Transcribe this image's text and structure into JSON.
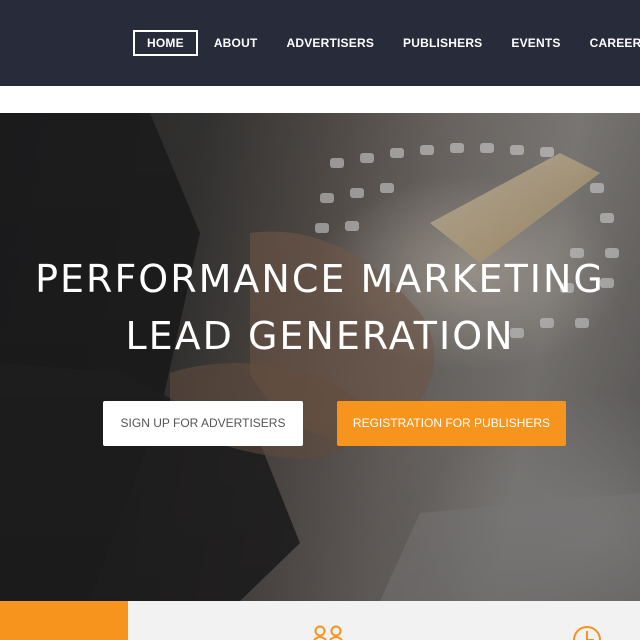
{
  "nav": {
    "items": [
      {
        "label": "HOME",
        "active": true
      },
      {
        "label": "ABOUT",
        "active": false
      },
      {
        "label": "ADVERTISERS",
        "active": false
      },
      {
        "label": "PUBLISHERS",
        "active": false
      },
      {
        "label": "EVENTS",
        "active": false
      },
      {
        "label": "CAREERS",
        "active": false
      }
    ]
  },
  "hero": {
    "title_line1": "PERFORMANCE MARKETING",
    "title_line2": "LEAD GENERATION",
    "buttons": {
      "advertisers": "SIGN UP FOR ADVERTISERS",
      "publishers": "REGISTRATION FOR PUBLISHERS"
    },
    "background": "business-person-using-phone-photo"
  },
  "strip": {
    "icons": [
      "people-icon",
      "clock-icon"
    ]
  },
  "colors": {
    "nav_bg": "#272b3a",
    "accent": "#f7941d",
    "strip_bg": "#f2f2f2",
    "white": "#ffffff"
  }
}
